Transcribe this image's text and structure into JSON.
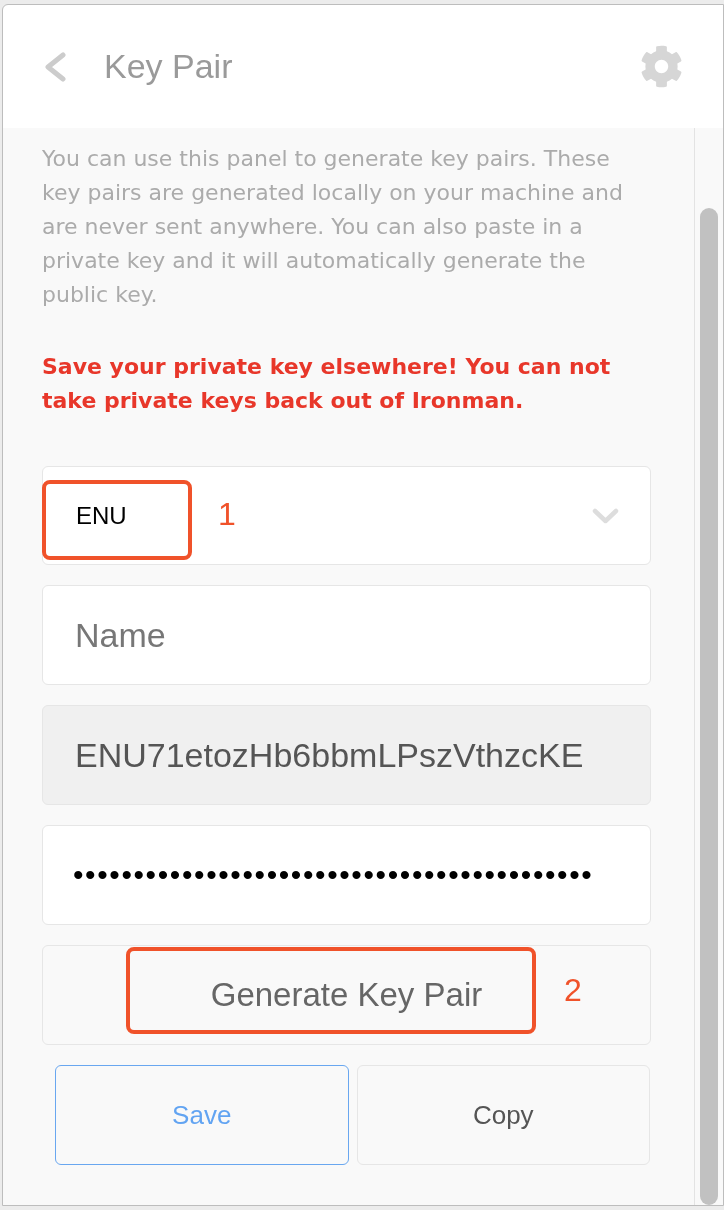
{
  "header": {
    "title": "Key Pair"
  },
  "intro": {
    "description": "You can use this panel to generate key pairs. These key pairs are generated locally on your machine and are never sent anywhere. You can also paste in a private key and it will automatically generate the public key.",
    "warning": "Save your private key elsewhere! You can not take private keys back out of Ironman."
  },
  "form": {
    "key_type_select": {
      "value": "ENU",
      "callout": "1"
    },
    "name_field": {
      "placeholder": "Name"
    },
    "public_key_field": {
      "value": "ENU71etozHb6bbmLPszVthzcKE",
      "disabled": true
    },
    "private_key_field": {
      "value": "•••••••••••••••••••••••••••••••••••••••••••"
    },
    "generate_button": {
      "label": "Generate Key Pair",
      "callout": "2"
    }
  },
  "buttons": [
    {
      "label": "Save",
      "focused": true
    },
    {
      "label": "Copy",
      "focused": false
    }
  ]
}
